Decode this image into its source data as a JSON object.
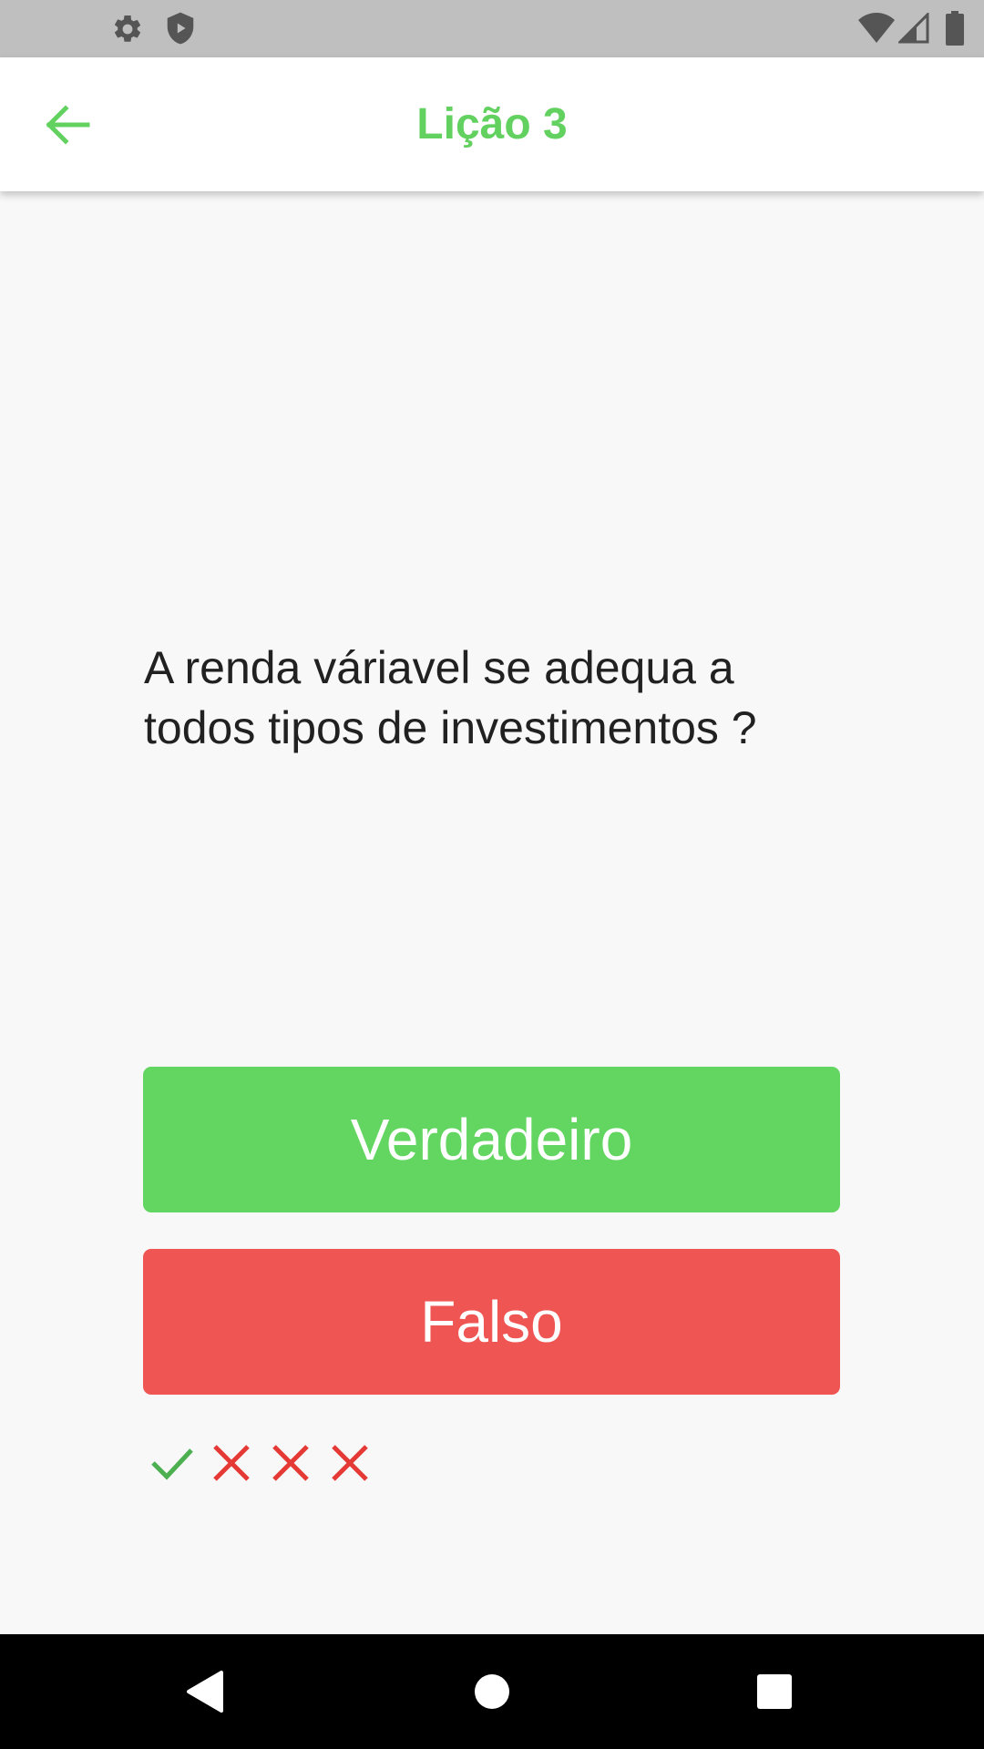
{
  "app_bar": {
    "title": "Lição 3",
    "back_icon": "arrow-left-icon",
    "accent_color": "#62d160"
  },
  "question": {
    "text": "A renda váriavel se adequa a todos tipos de investimentos ?"
  },
  "answers": {
    "true_label": "Verdadeiro",
    "true_color": "#62d660",
    "false_label": "Falso",
    "false_color": "#ef5552"
  },
  "progress": [
    {
      "result": "correct",
      "icon": "check-icon",
      "color": "#4caf50"
    },
    {
      "result": "wrong",
      "icon": "x-icon",
      "color": "#e53935"
    },
    {
      "result": "wrong",
      "icon": "x-icon",
      "color": "#e53935"
    },
    {
      "result": "wrong",
      "icon": "x-icon",
      "color": "#e53935"
    }
  ],
  "status_bar": {
    "left_icons": [
      "settings-icon",
      "shield-icon"
    ],
    "right_icons": [
      "wifi-icon",
      "cellular-signal-icon",
      "battery-icon"
    ]
  },
  "nav_bar": {
    "buttons": [
      "back-triangle-icon",
      "home-circle-icon",
      "recents-square-icon"
    ]
  }
}
